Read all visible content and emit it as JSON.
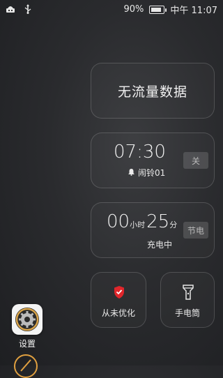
{
  "status": {
    "battery_percent": "90%",
    "time": "中午 11:07",
    "battery_level": 0.9,
    "icons": [
      "android-debug-icon",
      "usb-icon"
    ]
  },
  "cards": {
    "data": {
      "label": "无流量数据"
    },
    "alarm": {
      "time": "07:30",
      "toggle": "关",
      "label": "闹铃01"
    },
    "charge": {
      "hours": "00",
      "hours_unit": "小时",
      "minutes": "25",
      "minutes_unit": "分",
      "mode": "节电",
      "label": "充电中"
    },
    "optimize": {
      "label": "从未优化"
    },
    "torch": {
      "label": "手电筒"
    }
  },
  "app": {
    "settings_label": "设置"
  },
  "colors": {
    "shield_red": "#e0262b",
    "accent_orange": "#e0a040"
  }
}
